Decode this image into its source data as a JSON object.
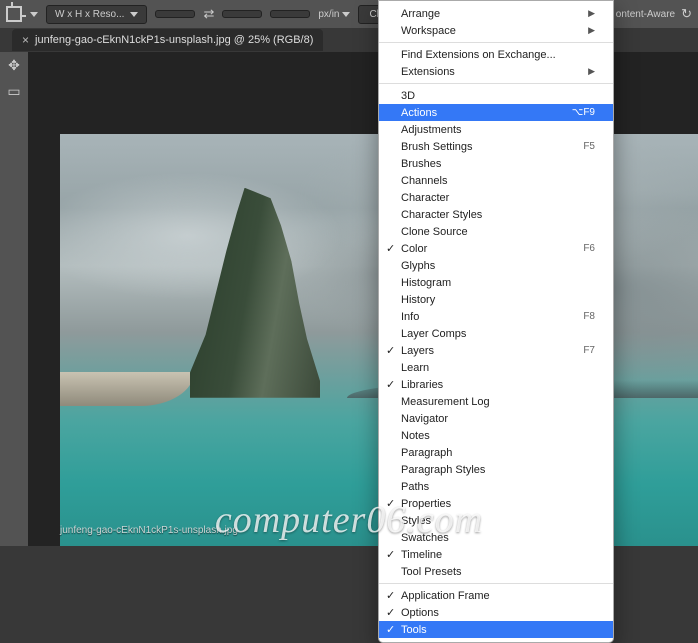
{
  "topbar": {
    "ratio_label": "W x H x Reso...",
    "units": "px/in",
    "clear": "Clear",
    "fill_fragment": "ontent-Aware"
  },
  "tab": {
    "title": "junfeng-gao-cEknN1ckP1s-unsplash.jpg @ 25% (RGB/8)",
    "close": "×"
  },
  "menu": {
    "arrange": "Arrange",
    "workspace": "Workspace",
    "find_ext": "Find Extensions on Exchange...",
    "extensions": "Extensions",
    "3d": "3D",
    "actions": {
      "label": "Actions",
      "shortcut": "⌥F9"
    },
    "adjustments": "Adjustments",
    "brush_settings": {
      "label": "Brush Settings",
      "shortcut": "F5"
    },
    "brushes": "Brushes",
    "channels": "Channels",
    "character": "Character",
    "character_styles": "Character Styles",
    "clone_source": "Clone Source",
    "color": {
      "label": "Color",
      "shortcut": "F6"
    },
    "glyphs": "Glyphs",
    "histogram": "Histogram",
    "history": "History",
    "info": {
      "label": "Info",
      "shortcut": "F8"
    },
    "layer_comps": "Layer Comps",
    "layers": {
      "label": "Layers",
      "shortcut": "F7"
    },
    "learn": "Learn",
    "libraries": "Libraries",
    "measurement_log": "Measurement Log",
    "navigator": "Navigator",
    "notes": "Notes",
    "paragraph": "Paragraph",
    "paragraph_styles": "Paragraph Styles",
    "paths": "Paths",
    "properties": "Properties",
    "styles": "Styles",
    "swatches": "Swatches",
    "timeline": "Timeline",
    "tool_presets": "Tool Presets",
    "app_frame": "Application Frame",
    "options": "Options",
    "tools": "Tools"
  },
  "footer_path": "junfeng-gao-cEknN1ckP1s-unsplash.jpg",
  "watermark": "computer06.com"
}
